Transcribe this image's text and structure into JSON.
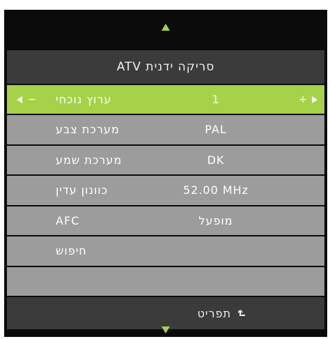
{
  "title": "סריקה ידנית ATV",
  "menu": {
    "items": [
      {
        "label": "ערוץ נוכחי",
        "value": "1"
      },
      {
        "label": "מערכת צבע",
        "value": "PAL"
      },
      {
        "label": "מערכת שמע",
        "value": "DK"
      },
      {
        "label": "כוונון עדין",
        "value": "52.00 MHz"
      },
      {
        "label": "AFC",
        "value": "מופעל"
      },
      {
        "label": "חיפוש",
        "value": ""
      },
      {
        "label": "",
        "value": ""
      }
    ]
  },
  "footer": {
    "menu_label": "תפריט"
  },
  "controls": {
    "minus": "−",
    "plus": "+"
  },
  "icons": {
    "up": "triangle-up",
    "down": "triangle-down",
    "left": "triangle-left",
    "right": "triangle-right",
    "return": "return-arrow"
  },
  "colors": {
    "accent": "#a6d24a",
    "row_bg": "#9c9c9c",
    "bar_bg": "#3b3b3b",
    "panel_bg": "#0b0b0b"
  }
}
